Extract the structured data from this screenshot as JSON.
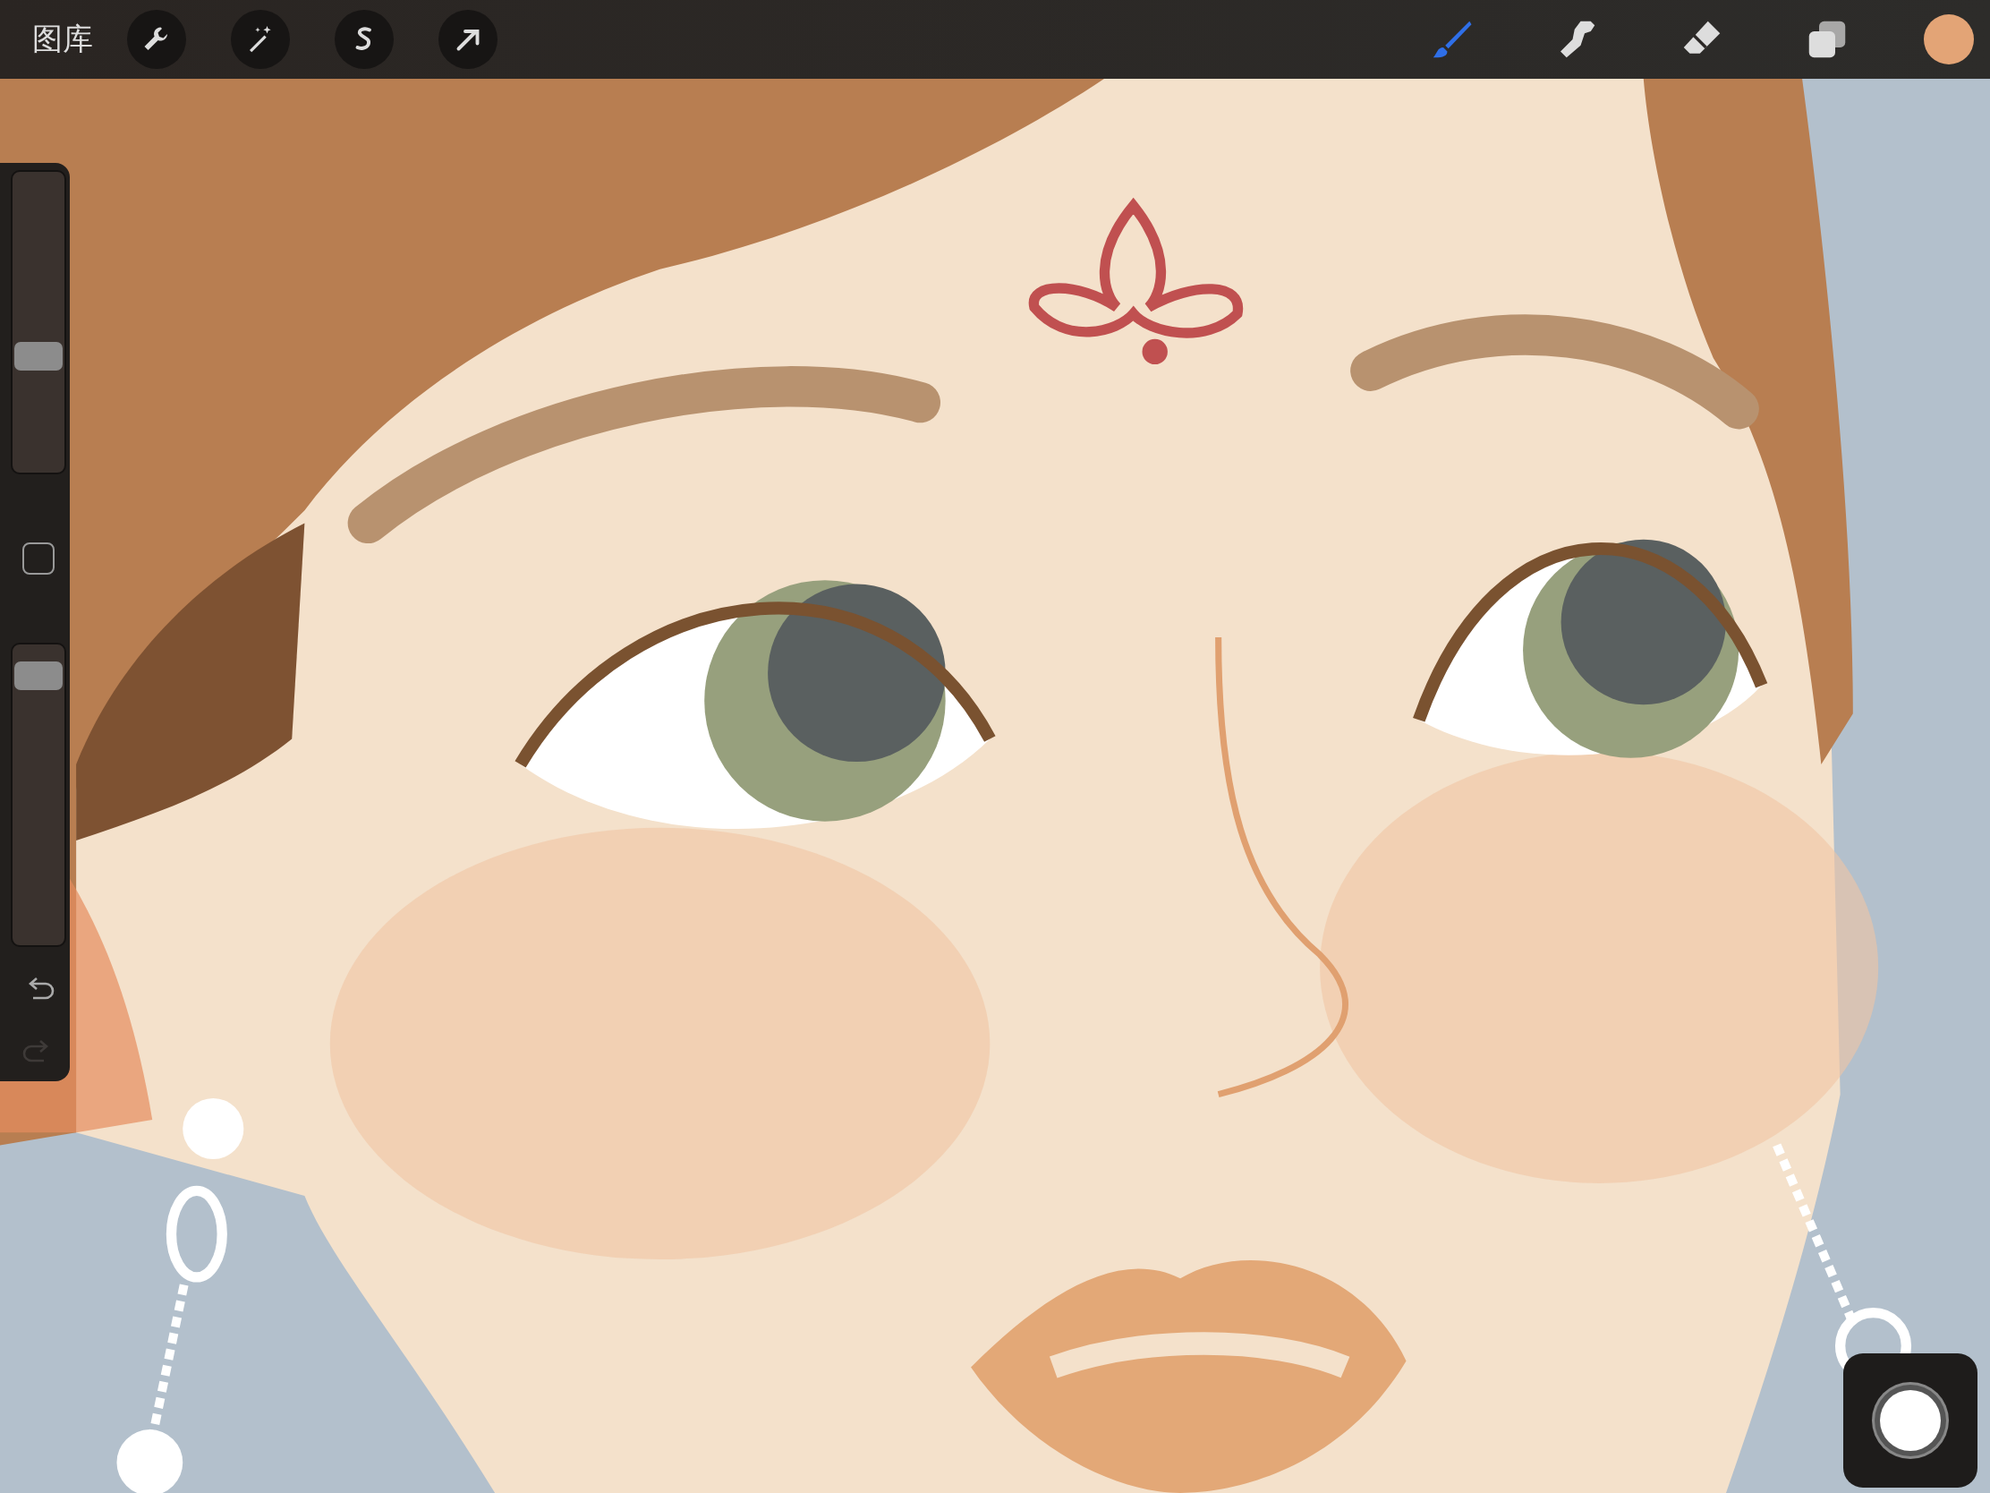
{
  "top_bar": {
    "gallery_label": "图库",
    "left_tools": [
      {
        "kind": "wrench"
      },
      {
        "kind": "wand"
      },
      {
        "kind": "selection"
      },
      {
        "kind": "transform"
      }
    ],
    "right_tools": [
      {
        "kind": "brush",
        "selected": true
      },
      {
        "kind": "smudge",
        "selected": false
      },
      {
        "kind": "eraser",
        "selected": false
      },
      {
        "kind": "layers",
        "selected": false
      }
    ],
    "current_color": {
      "color": "#e3a476"
    }
  },
  "sidebar": {
    "brush_size": {
      "level": 0.38
    },
    "opacity": {
      "level": 0.95
    },
    "undo": {
      "disabled": false
    },
    "redo": {
      "disabled": true
    }
  }
}
